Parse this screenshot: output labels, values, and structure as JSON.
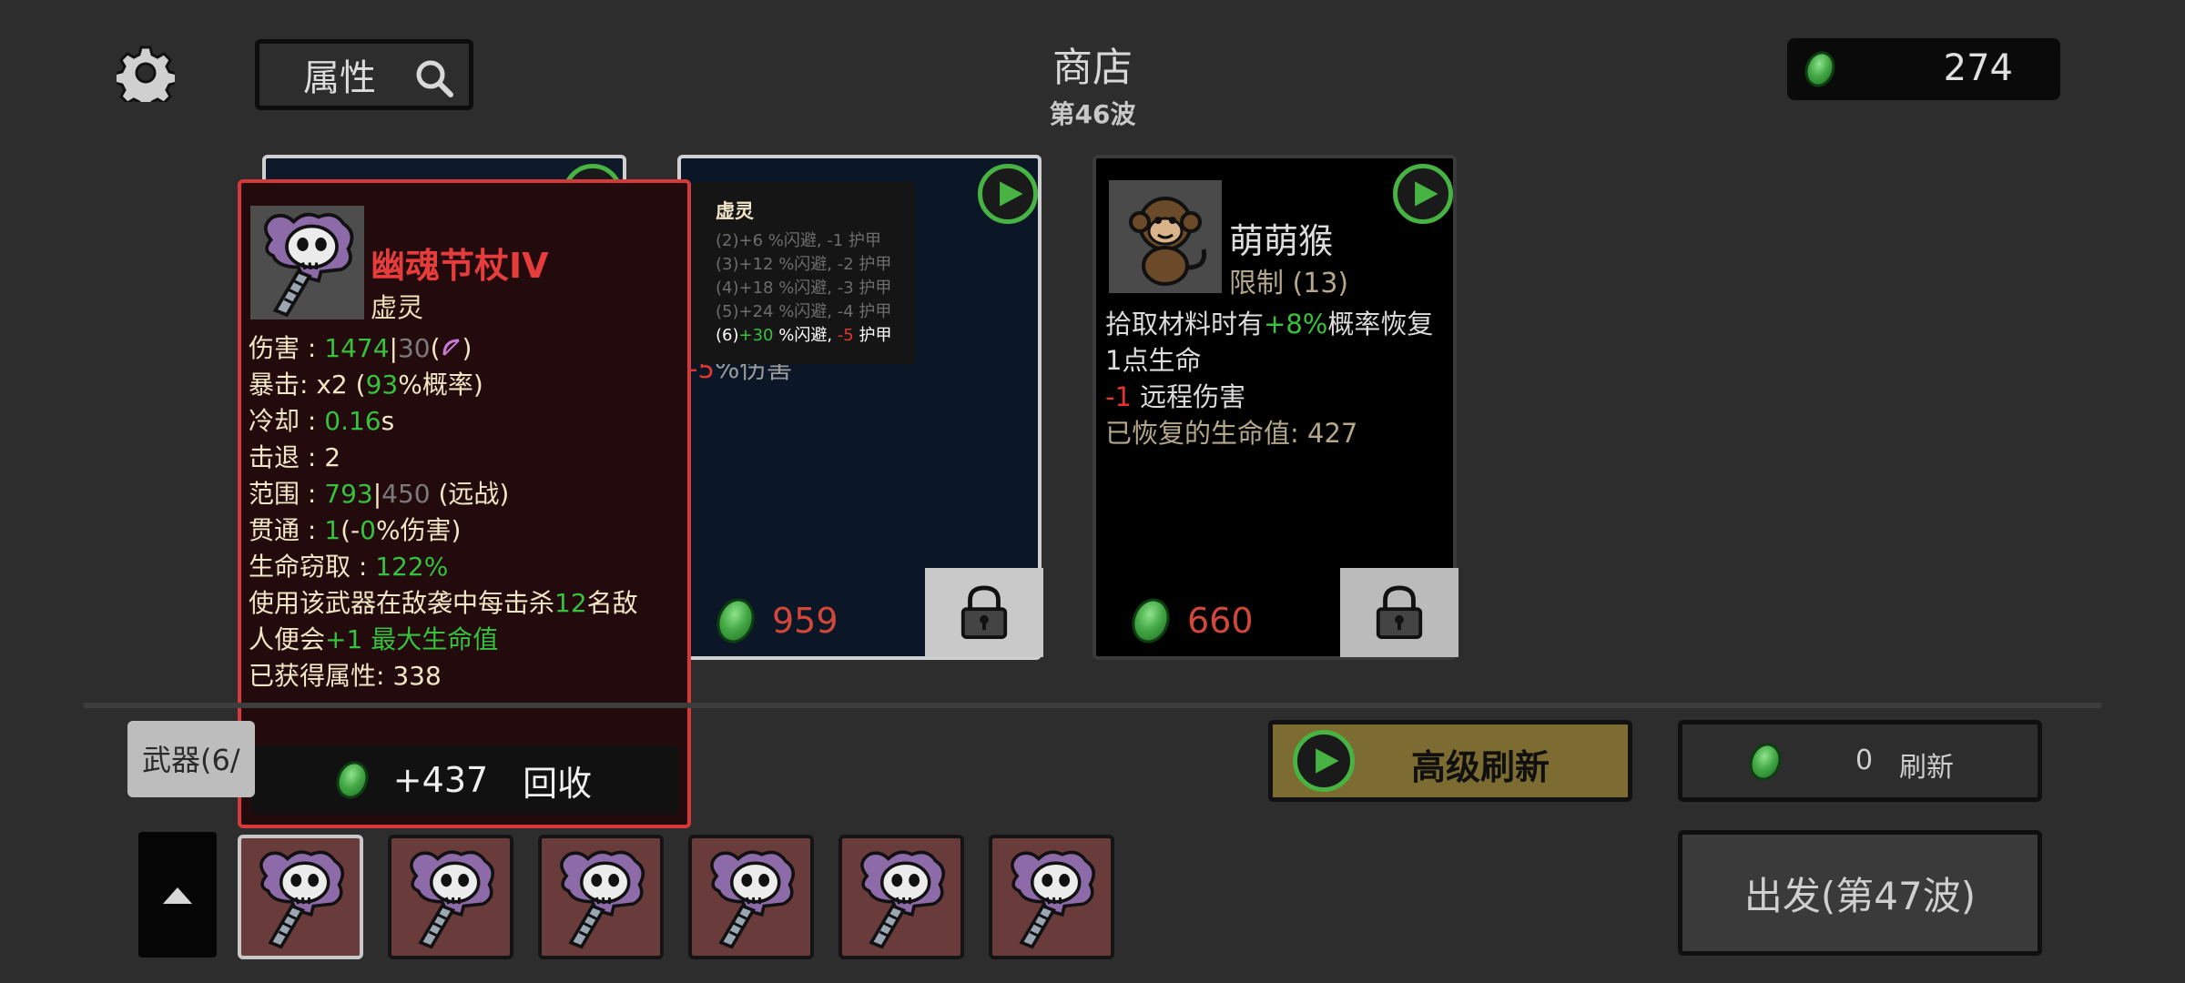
{
  "header": {
    "search_label": "属性",
    "title": "商店",
    "wave": "第46波",
    "money": "274"
  },
  "shop": {
    "cards": [
      {
        "price": "959",
        "locked": false
      },
      {
        "name": "萌萌猴",
        "limit": "限制 (13)",
        "desc_line1_pre": "拾取材料时有",
        "desc_line1_val": "+8%",
        "desc_line1_post": "概率恢复",
        "desc_line2": "1点生命",
        "desc_line3_val": "-1",
        "desc_line3_post": " 远程伤害",
        "desc_line4": "已恢复的生命值: 427",
        "price": "660",
        "locked": false
      }
    ],
    "partial_card_text": "%伤害",
    "partial_card_val": "-5"
  },
  "set_tooltip": {
    "title": "虚灵",
    "rows": [
      "(2)+6 %闪避, -1 护甲",
      "(3)+12 %闪避, -2 护甲",
      "(4)+18 %闪避, -3 护甲",
      "(5)+24 %闪避, -4 护甲"
    ],
    "active_prefix": "(6)",
    "active_dodge": "+30",
    "active_mid": " %闪避, ",
    "active_armor": "-5",
    "active_suffix": " 护甲"
  },
  "weapon_tooltip": {
    "name": "幽魂节杖IV",
    "type": "虚灵",
    "damage_label": "伤害 : ",
    "damage_val": "1474",
    "damage_base": "30",
    "crit_label": "暴击: ",
    "crit_mult": "x2",
    "crit_pre": "(",
    "crit_chance": "93",
    "crit_post": "%概率)",
    "cooldown_label": "冷却 : ",
    "cooldown_val": "0.16",
    "cooldown_unit": "s",
    "knockback_label": "击退 : ",
    "knockback_val": "2",
    "range_label": "范围 : ",
    "range_val": "793",
    "range_base": "450",
    "range_type": " (远战)",
    "pierce_label": "贯通 : ",
    "pierce_val": "1",
    "pierce_mid": "(-",
    "pierce_pct": "0",
    "pierce_post": "%伤害)",
    "lifesteal_label": "生命窃取 : ",
    "lifesteal_val": "122%",
    "effect_pre": "使用该武器在敌袭中每击杀",
    "effect_count": "12",
    "effect_mid": "名敌",
    "effect_line2_pre": "人便会",
    "effect_bonus": "+1 最大生命值",
    "gained": "已获得属性: 338",
    "recycle_value": "+437",
    "recycle_label": "回收"
  },
  "tabs": {
    "weapons": "武器(6/"
  },
  "buttons": {
    "advanced_refresh": "高级刷新",
    "refresh_cost": "0",
    "refresh": "刷新",
    "depart": "出发(第47波)"
  },
  "inventory": {
    "slots": [
      "幽魂节杖",
      "幽魂节杖",
      "幽魂节杖",
      "幽魂节杖",
      "幽魂节杖",
      "幽魂节杖"
    ],
    "selected_index": 0
  },
  "colors": {
    "background": "#2d2d2d",
    "accent_green": "#36c23a",
    "accent_red": "#e0362c",
    "tooltip_border": "#d43a3a",
    "refresh_gold": "#7d6c31"
  }
}
